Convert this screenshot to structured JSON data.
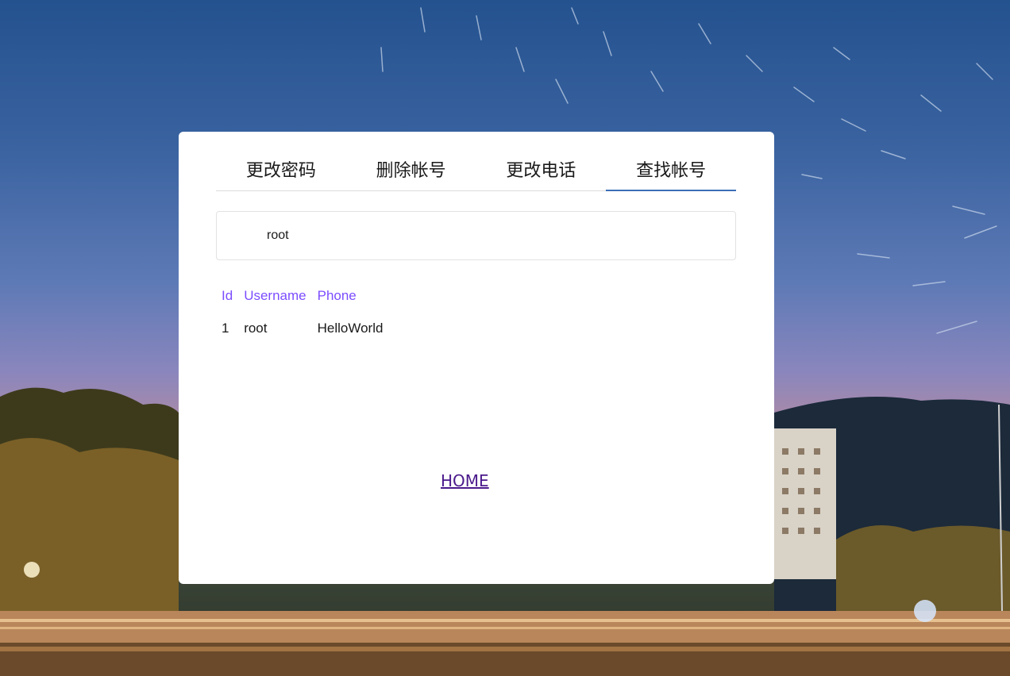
{
  "tabs": [
    {
      "label": "更改密码",
      "active": false
    },
    {
      "label": "删除帐号",
      "active": false
    },
    {
      "label": "更改电话",
      "active": false
    },
    {
      "label": "查找帐号",
      "active": true
    }
  ],
  "search": {
    "value": "root"
  },
  "table": {
    "headers": [
      "Id",
      "Username",
      "Phone"
    ],
    "rows": [
      [
        "1",
        "root",
        "HelloWorld"
      ]
    ]
  },
  "home_link": "HOME",
  "colors": {
    "header_text": "#7c4dff",
    "tab_underline": "#3b6fb6",
    "link": "#4b1a8c"
  }
}
